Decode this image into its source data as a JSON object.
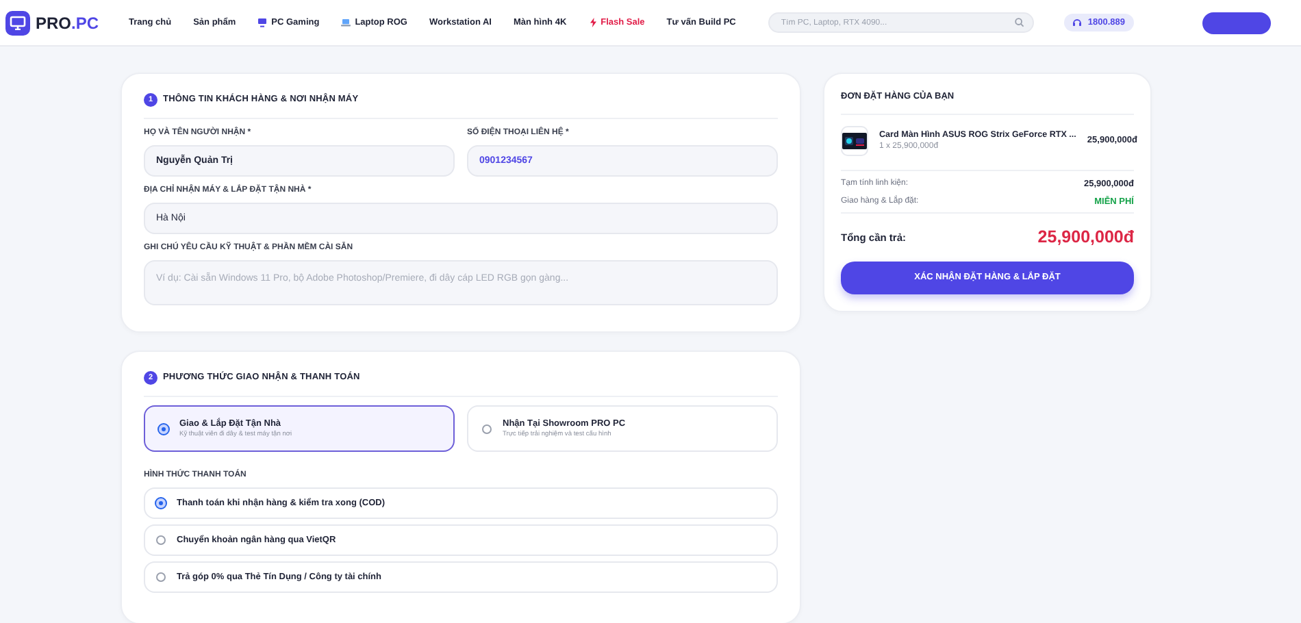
{
  "header": {
    "logo": "PRO",
    "logo_accent": ".PC",
    "menu": [
      {
        "label": "Trang chủ",
        "kind": "text"
      },
      {
        "label": "Sản phẩm",
        "kind": "text"
      },
      {
        "label": "PC Gaming",
        "kind": "monitor"
      },
      {
        "label": "Laptop ROG",
        "kind": "laptop"
      },
      {
        "label": "Workstation AI",
        "kind": "text"
      },
      {
        "label": "Màn hình 4K",
        "kind": "text"
      },
      {
        "label": "Flash Sale",
        "kind": "flash"
      },
      {
        "label": "Tư vấn Build PC",
        "kind": "text"
      }
    ],
    "search": {
      "placeholder": "Tìm PC, Laptop, RTX 4090..."
    },
    "hotline": "1800.889"
  },
  "customer": {
    "step": "1",
    "title": "THÔNG TIN KHÁCH HÀNG & NƠI NHẬN MÁY",
    "fields": [
      {
        "label": "HỌ VÀ TÊN NGƯỜI NHẬN *",
        "value": "Nguyễn Quản Trị",
        "kind": "half"
      },
      {
        "label": "SỐ ĐIỆN THOẠI LIÊN HỆ *",
        "value": "0901234567",
        "kind": "phone"
      },
      {
        "label": "ĐỊA CHỈ NHẬN MÁY & LẮP ĐẶT TẬN NHÀ *",
        "value": "Hà Nội",
        "kind": "full"
      },
      {
        "label": "GHI CHÚ YÊU CẦU KỸ THUẬT & PHẦN MỀM CÀI SẴN",
        "placeholder": "Ví dụ: Cài sẵn Windows 11 Pro, bộ Adobe Photoshop/Premiere, đi dây cáp LED RGB gọn gàng...",
        "kind": "textarea"
      }
    ]
  },
  "delivery": {
    "step": "2",
    "title": "PHƯƠNG THỨC GIAO NHẬN & THANH TOÁN",
    "options": [
      {
        "title": "Giao & Lắp Đặt Tận Nhà",
        "subtitle": "Kỹ thuật viên đi dây & test máy tận nơi",
        "selected": true
      },
      {
        "title": "Nhận Tại Showroom PRO PC",
        "subtitle": "Trực tiếp trải nghiệm và test cấu hình",
        "selected": false
      }
    ],
    "payment_label": "HÌNH THỨC THANH TOÁN",
    "payments": [
      {
        "label": "Thanh toán khi nhận hàng & kiểm tra xong (COD)",
        "selected": true
      },
      {
        "label": "Chuyển khoản ngân hàng qua VietQR",
        "selected": false
      },
      {
        "label": "Trả góp 0% qua Thẻ Tín Dụng / Công ty tài chính",
        "selected": false
      }
    ]
  },
  "order": {
    "title": "ĐƠN ĐẶT HÀNG CỦA BẠN",
    "items": [
      {
        "name": "Card Màn Hình ASUS ROG Strix GeForce RTX ...",
        "qty_price": "1 x 25,900,000đ",
        "price": "25,900,000đ"
      }
    ],
    "rows": [
      {
        "label": "Tạm tính linh kiện:",
        "value": "25,900,000đ",
        "kind": "plain"
      },
      {
        "label": "Giao hàng & Lắp đặt:",
        "value": "MIỄN PHÍ",
        "kind": "free"
      }
    ],
    "total_label": "Tổng cần trả:",
    "total": "25,900,000đ",
    "button": "XÁC NHẬN ĐẶT HÀNG & LẮP ĐẶT"
  }
}
